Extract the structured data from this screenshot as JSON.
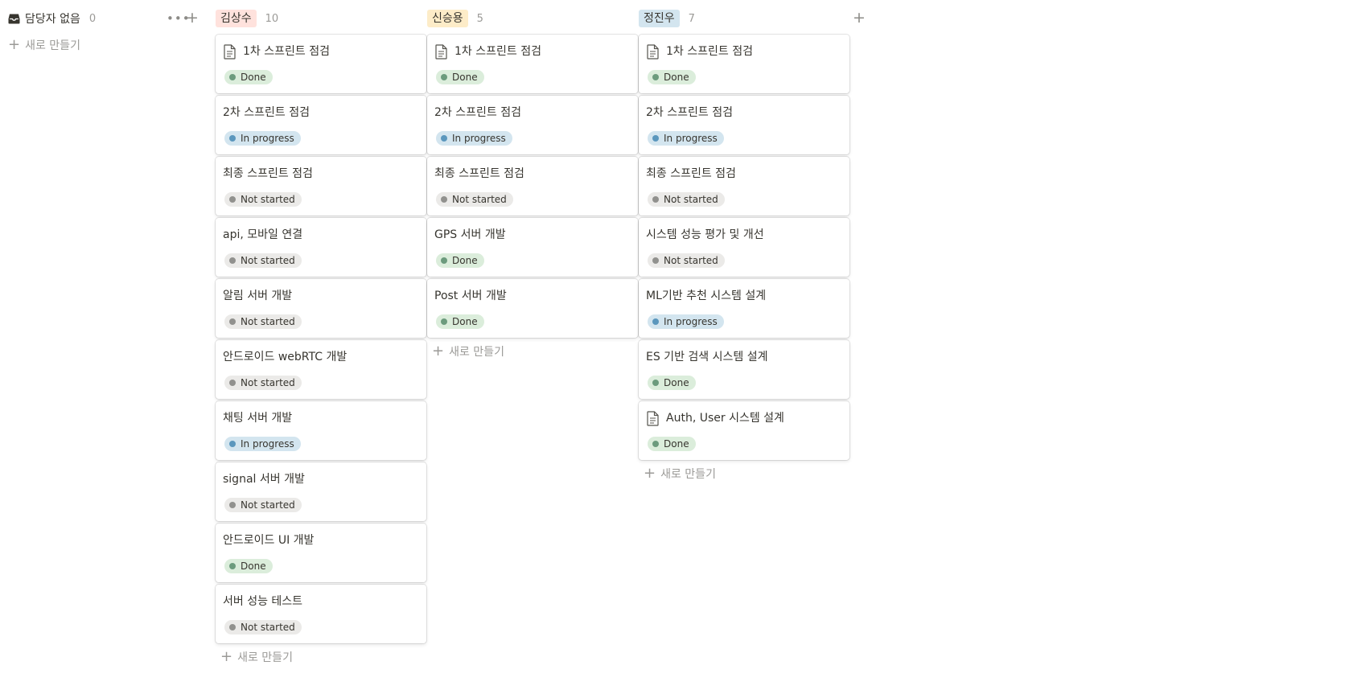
{
  "no_assignee": {
    "title": "담당자 없음",
    "count": "0",
    "more_icon": "more-horizontal-icon",
    "add_icon": "plus-icon",
    "new_label": "새로 만들기"
  },
  "statuses": {
    "done": {
      "label": "Done",
      "bg": "#dbeddb",
      "dot": "#6c9b7d"
    },
    "in_progress": {
      "label": "In progress",
      "bg": "#d3e5ef",
      "dot": "#5b97bd"
    },
    "not_started": {
      "label": "Not started",
      "bg": "#ebeae8",
      "dot": "#91918e"
    }
  },
  "columns": [
    {
      "name": "김상수",
      "count": "10",
      "color": "#ffe2dd",
      "new_label": "새로 만들기",
      "cards": [
        {
          "title": "1차 스프린트 점검",
          "doc": true,
          "status": "Done"
        },
        {
          "title": "2차 스프린트 점검",
          "doc": false,
          "status": "In progress"
        },
        {
          "title": "최종 스프린트 점검",
          "doc": false,
          "status": "Not started"
        },
        {
          "title": "api, 모바일 연결",
          "doc": false,
          "status": "Not started"
        },
        {
          "title": "알림 서버 개발",
          "doc": false,
          "status": "Not started"
        },
        {
          "title": "안드로이드 webRTC 개발",
          "doc": false,
          "status": "Not started"
        },
        {
          "title": "채팅 서버 개발",
          "doc": false,
          "status": "In progress"
        },
        {
          "title": "signal 서버 개발",
          "doc": false,
          "status": "Not started"
        },
        {
          "title": "안드로이드 UI 개발",
          "doc": false,
          "status": "Done"
        },
        {
          "title": "서버 성능 테스트",
          "doc": false,
          "status": "Not started"
        }
      ]
    },
    {
      "name": "신승용",
      "count": "5",
      "color": "#fdecc8",
      "new_label": "새로 만들기",
      "cards": [
        {
          "title": "1차 스프린트 점검",
          "doc": true,
          "status": "Done"
        },
        {
          "title": "2차 스프린트 점검",
          "doc": false,
          "status": "In progress"
        },
        {
          "title": "최종 스프린트 점검",
          "doc": false,
          "status": "Not started"
        },
        {
          "title": "GPS 서버 개발",
          "doc": false,
          "status": "Done"
        },
        {
          "title": "Post 서버 개발",
          "doc": false,
          "status": "Done"
        }
      ]
    },
    {
      "name": "정진우",
      "count": "7",
      "color": "#d3e5ef",
      "new_label": "새로 만들기",
      "cards": [
        {
          "title": "1차 스프린트 점검",
          "doc": true,
          "status": "Done"
        },
        {
          "title": "2차 스프린트 점검",
          "doc": false,
          "status": "In progress"
        },
        {
          "title": "최종 스프린트 점검",
          "doc": false,
          "status": "Not started"
        },
        {
          "title": "시스템 성능 평가 및 개선",
          "doc": false,
          "status": "Not started"
        },
        {
          "title": "ML기반 추천 시스템 설계",
          "doc": false,
          "status": "In progress"
        },
        {
          "title": "ES 기반 검색 시스템 설계",
          "doc": false,
          "status": "Done"
        },
        {
          "title": "Auth, User 시스템 설계",
          "doc": true,
          "status": "Done"
        }
      ]
    }
  ],
  "add_group_icon": "plus-icon"
}
